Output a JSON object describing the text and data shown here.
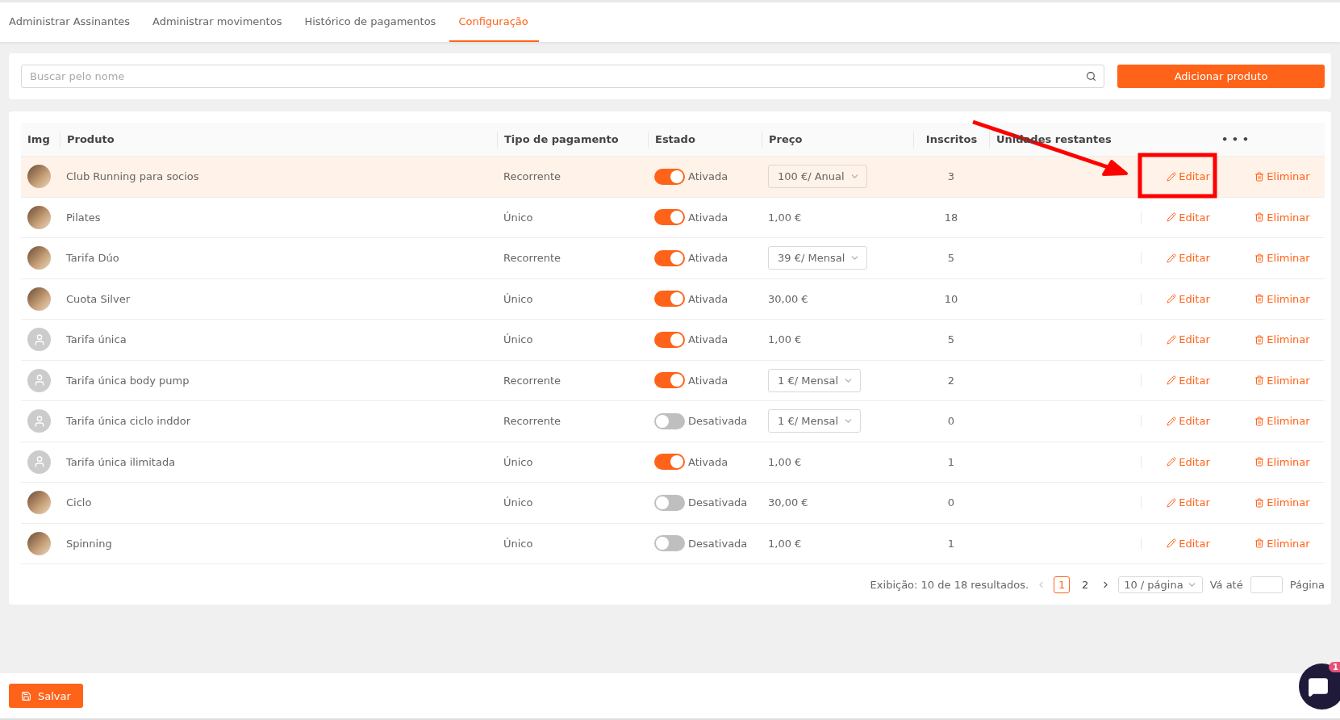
{
  "tabs": [
    {
      "label": "Administrar Assinantes",
      "selected": false
    },
    {
      "label": "Administrar movimentos",
      "selected": false
    },
    {
      "label": "Histórico de pagamentos",
      "selected": false
    },
    {
      "label": "Configuração",
      "selected": true
    }
  ],
  "search": {
    "placeholder": "Buscar pelo nome"
  },
  "add_button": "Adicionar produto",
  "table": {
    "columns": [
      "Img",
      "Produto",
      "Tipo de pagamento",
      "Estado",
      "Preço",
      "Inscritos",
      "Unidades restantes",
      "• • •"
    ],
    "rows": [
      {
        "image": {
          "kind": "photo"
        },
        "product": "Club Running para socios",
        "payment": "Recorrente",
        "on": true,
        "state": "Ativada",
        "price": {
          "kind": "select",
          "text": "100 €/ Anual"
        },
        "subscribers": "3",
        "edit": "Editar",
        "delete": "Eliminar",
        "selected": true
      },
      {
        "image": {
          "kind": "photo"
        },
        "product": "Pilates",
        "payment": "Único",
        "on": true,
        "state": "Ativada",
        "price": {
          "kind": "text",
          "text": "1,00 €"
        },
        "subscribers": "18",
        "edit": "Editar",
        "delete": "Eliminar",
        "selected": false
      },
      {
        "image": {
          "kind": "photo"
        },
        "product": "Tarifa Dúo",
        "payment": "Recorrente",
        "on": true,
        "state": "Ativada",
        "price": {
          "kind": "select",
          "text": "39 €/ Mensal"
        },
        "subscribers": "5",
        "edit": "Editar",
        "delete": "Eliminar",
        "selected": false
      },
      {
        "image": {
          "kind": "photo"
        },
        "product": "Cuota Silver",
        "payment": "Único",
        "on": true,
        "state": "Ativada",
        "price": {
          "kind": "text",
          "text": "30,00 €"
        },
        "subscribers": "10",
        "edit": "Editar",
        "delete": "Eliminar",
        "selected": false
      },
      {
        "image": {
          "kind": "placeholder"
        },
        "product": "Tarifa única",
        "payment": "Único",
        "on": true,
        "state": "Ativada",
        "price": {
          "kind": "text",
          "text": "1,00 €"
        },
        "subscribers": "5",
        "edit": "Editar",
        "delete": "Eliminar",
        "selected": false
      },
      {
        "image": {
          "kind": "placeholder"
        },
        "product": "Tarifa única body pump",
        "payment": "Recorrente",
        "on": true,
        "state": "Ativada",
        "price": {
          "kind": "select",
          "text": "1 €/ Mensal"
        },
        "subscribers": "2",
        "edit": "Editar",
        "delete": "Eliminar",
        "selected": false
      },
      {
        "image": {
          "kind": "placeholder"
        },
        "product": "Tarifa única ciclo inddor",
        "payment": "Recorrente",
        "on": false,
        "state": "Desativada",
        "price": {
          "kind": "select",
          "text": "1 €/ Mensal"
        },
        "subscribers": "0",
        "edit": "Editar",
        "delete": "Eliminar",
        "selected": false
      },
      {
        "image": {
          "kind": "placeholder"
        },
        "product": "Tarifa única ilimitada",
        "payment": "Único",
        "on": true,
        "state": "Ativada",
        "price": {
          "kind": "text",
          "text": "1,00 €"
        },
        "subscribers": "1",
        "edit": "Editar",
        "delete": "Eliminar",
        "selected": false
      },
      {
        "image": {
          "kind": "photo"
        },
        "product": "Ciclo",
        "payment": "Único",
        "on": false,
        "state": "Desativada",
        "price": {
          "kind": "text",
          "text": "30,00 €"
        },
        "subscribers": "0",
        "edit": "Editar",
        "delete": "Eliminar",
        "selected": false
      },
      {
        "image": {
          "kind": "photo"
        },
        "product": "Spinning",
        "payment": "Único",
        "on": false,
        "state": "Desativada",
        "price": {
          "kind": "text",
          "text": "1,00 €"
        },
        "subscribers": "1",
        "edit": "Editar",
        "delete": "Eliminar",
        "selected": false
      }
    ]
  },
  "pagination": {
    "summary": "Exibição: 10 de 18 resultados.",
    "pages": [
      {
        "label": "1",
        "selected": true
      },
      {
        "label": "2",
        "selected": false
      }
    ],
    "page_size": "10 / página",
    "goto_label": "Vá até",
    "page_label": "Página"
  },
  "annotation": {
    "kind": "arrow-box"
  },
  "save_button": "Salvar",
  "chat": {
    "badge": "1"
  }
}
